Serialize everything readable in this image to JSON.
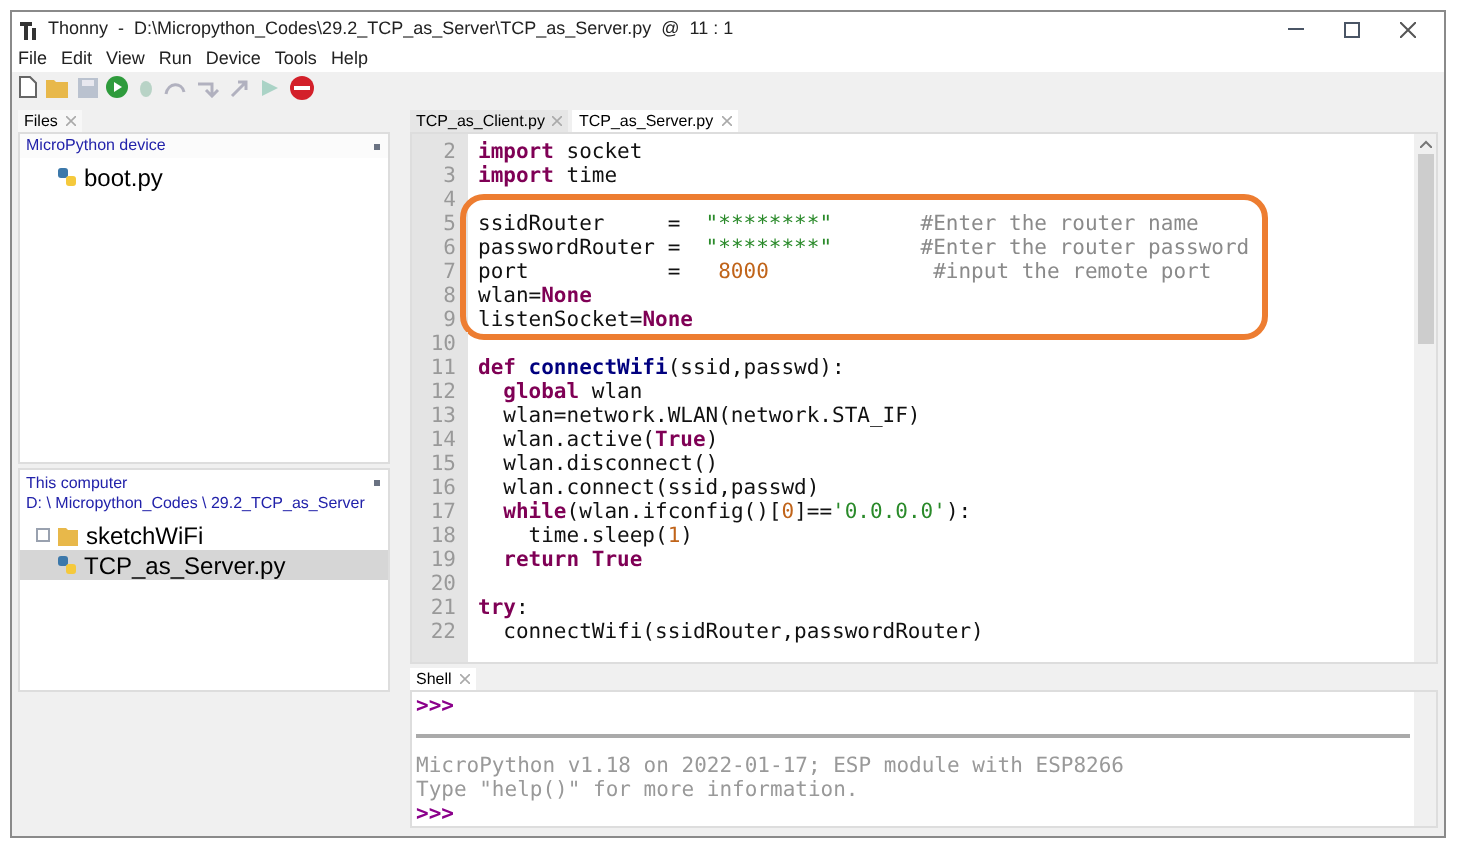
{
  "window": {
    "title": "Thonny  -  D:\\Micropython_Codes\\29.2_TCP_as_Server\\TCP_as_Server.py  @  11 : 1"
  },
  "menu": [
    "File",
    "Edit",
    "View",
    "Run",
    "Device",
    "Tools",
    "Help"
  ],
  "toolbar": [
    {
      "kind": "new",
      "disabled": false
    },
    {
      "kind": "open",
      "disabled": false
    },
    {
      "kind": "save",
      "disabled": true
    },
    {
      "kind": "run",
      "disabled": false
    },
    {
      "kind": "debug",
      "disabled": true
    },
    {
      "kind": "step-over",
      "disabled": true
    },
    {
      "kind": "step-into",
      "disabled": true
    },
    {
      "kind": "step-out",
      "disabled": true
    },
    {
      "kind": "resume",
      "disabled": true
    },
    {
      "kind": "stop",
      "disabled": false
    }
  ],
  "files_panel": {
    "tab": "Files",
    "device": {
      "title": "MicroPython device",
      "items": [
        {
          "kind": "python",
          "name": "boot.py",
          "selected": false
        }
      ]
    },
    "computer": {
      "title": "This computer",
      "path": "D: \\ Micropython_Codes \\ 29.2_TCP_as_Server",
      "items": [
        {
          "kind": "folder",
          "name": "sketchWiFi",
          "selected": false
        },
        {
          "kind": "python",
          "name": "TCP_as_Server.py",
          "selected": true
        }
      ]
    }
  },
  "editor": {
    "tabs": [
      {
        "label": "TCP_as_Client.py",
        "selected": false
      },
      {
        "label": "TCP_as_Server.py",
        "selected": true
      }
    ],
    "blocks": [
      {
        "outlined": false,
        "lines": [
          {
            "number": "2",
            "tokens": [
              {
                "kind": "keyword",
                "text": "import"
              },
              {
                "kind": "plain",
                "text": " socket"
              }
            ]
          },
          {
            "number": "3",
            "tokens": [
              {
                "kind": "keyword",
                "text": "import"
              },
              {
                "kind": "plain",
                "text": " time"
              }
            ]
          }
        ]
      },
      {
        "outlined": true,
        "lines": [
          {
            "number": "4"
          },
          {
            "number": "5",
            "tokens": [
              {
                "kind": "plain",
                "text": "ssidRouter     =  "
              },
              {
                "kind": "string",
                "text": "\"********\""
              },
              {
                "kind": "comment",
                "text": "       #Enter the router name"
              }
            ]
          },
          {
            "number": "6",
            "tokens": [
              {
                "kind": "plain",
                "text": "passwordRouter =  "
              },
              {
                "kind": "string",
                "text": "\"********\""
              },
              {
                "kind": "comment",
                "text": "       #Enter the router password"
              }
            ]
          },
          {
            "number": "7",
            "tokens": [
              {
                "kind": "plain",
                "text": "port           =   "
              },
              {
                "kind": "number",
                "text": "8000"
              },
              {
                "kind": "comment",
                "text": "             #input the remote port"
              }
            ]
          },
          {
            "number": "8",
            "tokens": [
              {
                "kind": "plain",
                "text": "wlan="
              },
              {
                "kind": "constant",
                "text": "None"
              }
            ]
          },
          {
            "number": "9",
            "tokens": [
              {
                "kind": "plain",
                "text": "listenSocket="
              },
              {
                "kind": "constant",
                "text": "None"
              }
            ]
          }
        ]
      },
      {
        "outlined": false,
        "lines": [
          {
            "number": "10"
          },
          {
            "number": "11",
            "tokens": [
              {
                "kind": "keyword",
                "text": "def"
              },
              {
                "kind": "defname",
                "text": " connectWifi"
              },
              {
                "kind": "plain",
                "text": "(ssid,passwd):"
              }
            ]
          },
          {
            "number": "12",
            "tokens": [
              {
                "kind": "keyword",
                "text": "  global"
              },
              {
                "kind": "plain",
                "text": " wlan"
              }
            ]
          },
          {
            "number": "13",
            "tokens": [
              {
                "kind": "plain",
                "text": "  wlan=network.WLAN(network.STA_IF)"
              }
            ]
          },
          {
            "number": "14",
            "tokens": [
              {
                "kind": "plain",
                "text": "  wlan.active("
              },
              {
                "kind": "constant",
                "text": "True"
              },
              {
                "kind": "plain",
                "text": ")"
              }
            ]
          },
          {
            "number": "15",
            "tokens": [
              {
                "kind": "plain",
                "text": "  wlan.disconnect()"
              }
            ]
          },
          {
            "number": "16",
            "tokens": [
              {
                "kind": "plain",
                "text": "  wlan.connect(ssid,passwd)"
              }
            ]
          },
          {
            "number": "17",
            "tokens": [
              {
                "kind": "keyword",
                "text": "  while"
              },
              {
                "kind": "plain",
                "text": "(wlan.ifconfig()["
              },
              {
                "kind": "number",
                "text": "0"
              },
              {
                "kind": "plain",
                "text": "]=="
              },
              {
                "kind": "string",
                "text": "'0.0.0.0'"
              },
              {
                "kind": "plain",
                "text": "):"
              }
            ]
          },
          {
            "number": "18",
            "tokens": [
              {
                "kind": "plain",
                "text": "    time.sleep("
              },
              {
                "kind": "number",
                "text": "1"
              },
              {
                "kind": "plain",
                "text": ")"
              }
            ]
          },
          {
            "number": "19",
            "tokens": [
              {
                "kind": "keyword",
                "text": "  return"
              },
              {
                "kind": "constant",
                "text": " True"
              }
            ]
          },
          {
            "number": "20"
          },
          {
            "number": "21",
            "tokens": [
              {
                "kind": "keyword",
                "text": "try"
              },
              {
                "kind": "plain",
                "text": ":"
              }
            ]
          },
          {
            "number": "22",
            "tokens": [
              {
                "kind": "plain",
                "text": "  connectWifi(ssidRouter,passwordRouter)"
              }
            ]
          }
        ]
      }
    ]
  },
  "shell": {
    "tab": "Shell",
    "prompt": ">>>",
    "lines": [
      "MicroPython v1.18 on 2022-01-17; ESP module with ESP8266",
      "Type \"help()\" for more information."
    ],
    "prompt_after": ">>>"
  }
}
